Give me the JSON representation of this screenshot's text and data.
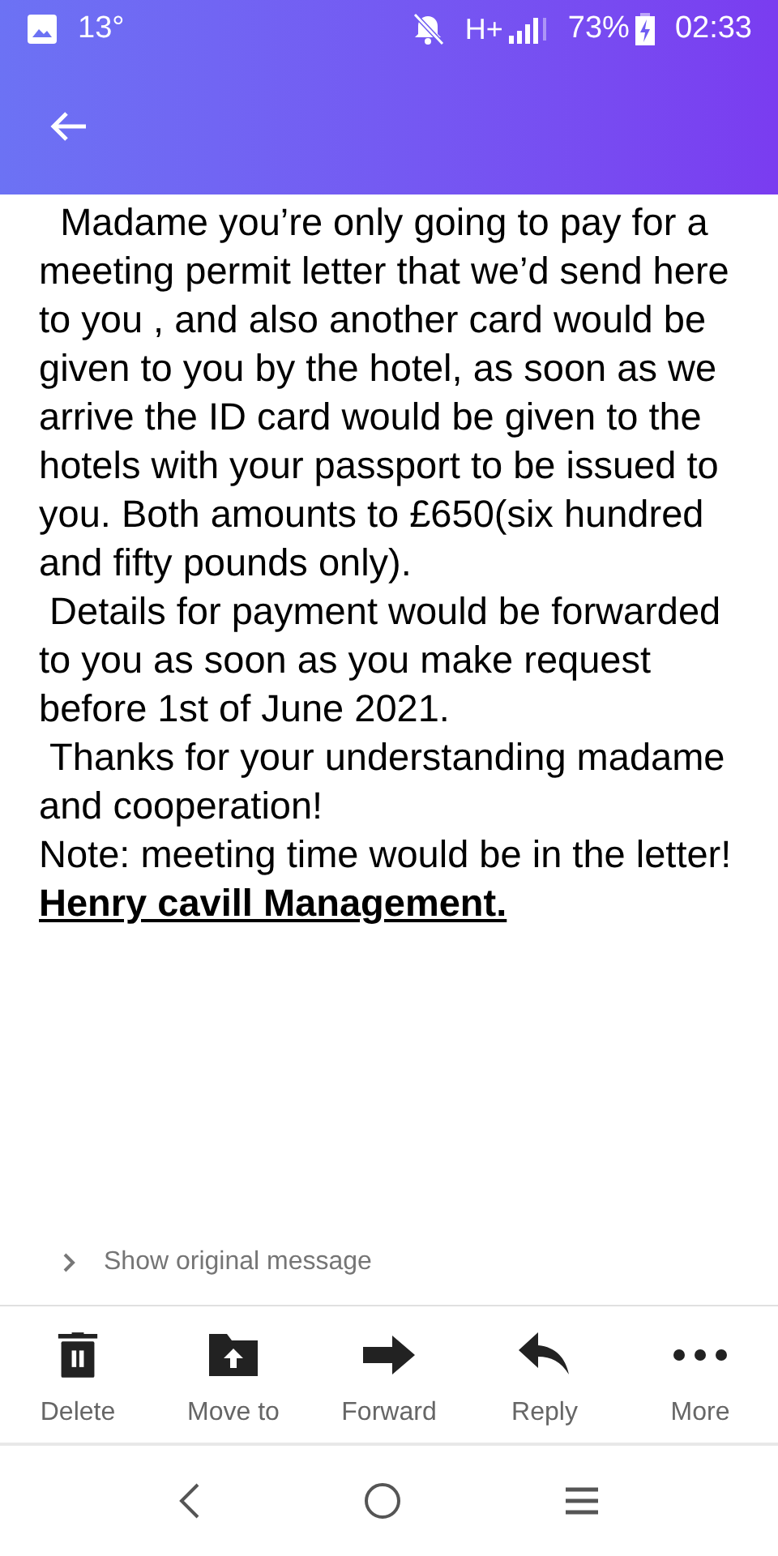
{
  "status_bar": {
    "temperature": "13°",
    "network": "H+",
    "battery": "73%",
    "time": "02:33"
  },
  "message": {
    "paragraphs": [
      {
        "kind": "text",
        "text": "  Madame you’re only going to pay for a meeting permit letter that we’d send here to you , and also another card would be given to you by the hotel, as soon as we arrive the ID card would be given to the hotels with your passport to be issued to you. Both amounts to £650(six hundred and fifty pounds only)."
      },
      {
        "kind": "text",
        "text": " Details for payment would be forwarded to you as soon as you make request before 1st of June 2021."
      },
      {
        "kind": "text",
        "text": " Thanks for your understanding madame and cooperation!"
      },
      {
        "kind": "text",
        "text": "Note: meeting time would be in the letter!"
      },
      {
        "kind": "signature",
        "text": "Henry cavill Management."
      }
    ],
    "show_original": "Show original message"
  },
  "actions": [
    {
      "kind": "delete",
      "label": "Delete"
    },
    {
      "kind": "move",
      "label": "Move to"
    },
    {
      "kind": "forward",
      "label": "Forward"
    },
    {
      "kind": "reply",
      "label": "Reply"
    },
    {
      "kind": "more",
      "label": "More"
    }
  ]
}
